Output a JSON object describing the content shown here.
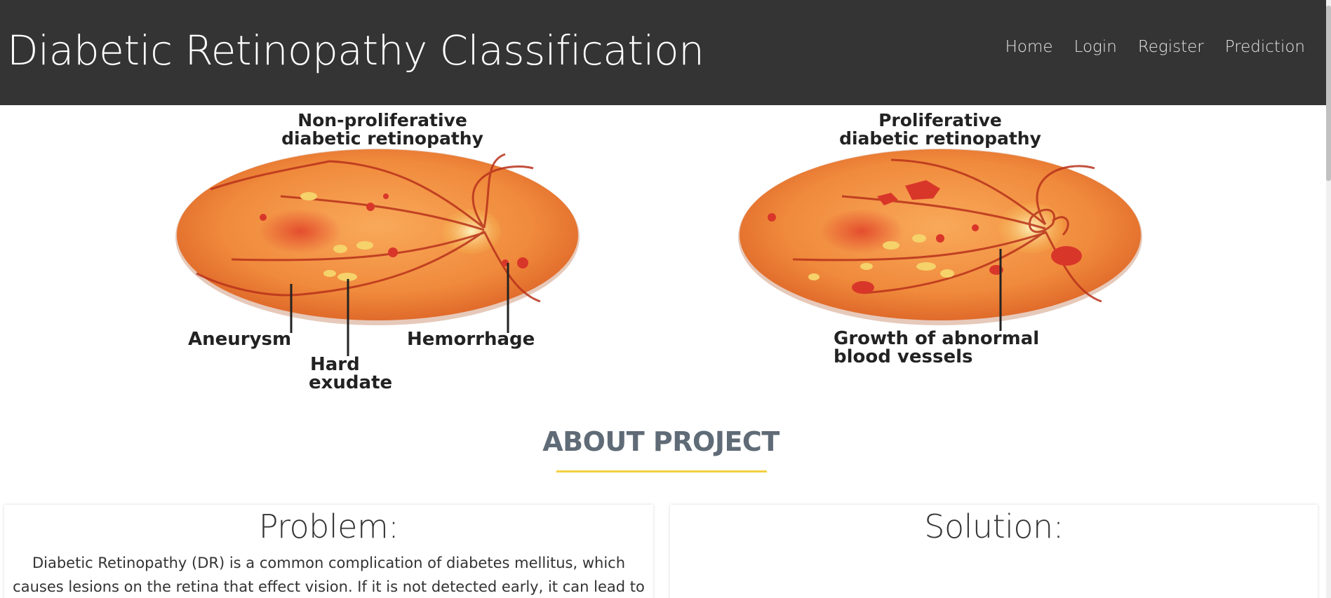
{
  "header": {
    "brand": "Diabetic Retinopathy Classification",
    "nav": [
      "Home",
      "Login",
      "Register",
      "Prediction"
    ]
  },
  "hero": {
    "left_title_1": "Non-proliferative",
    "left_title_2": "diabetic retinopathy",
    "right_title_1": "Proliferative",
    "right_title_2": "diabetic retinopathy",
    "label_aneurysm": "Aneurysm",
    "label_hemorrhage": "Hemorrhage",
    "label_hard_1": "Hard",
    "label_hard_2": "exudate",
    "label_growth_1": "Growth of abnormal",
    "label_growth_2": "blood vessels"
  },
  "about": {
    "title": "ABOUT PROJECT"
  },
  "cards": {
    "problem_title": "Problem:",
    "problem_text": "Diabetic Retinopathy (DR) is a common complication of diabetes mellitus, which causes lesions on the retina that effect vision. If it is not detected early, it can lead to",
    "solution_title": "Solution:"
  },
  "colors": {
    "navbar": "#343434",
    "accent_underline": "#f4d03f",
    "retina": "#f0873a",
    "vessel": "#b8321b"
  }
}
